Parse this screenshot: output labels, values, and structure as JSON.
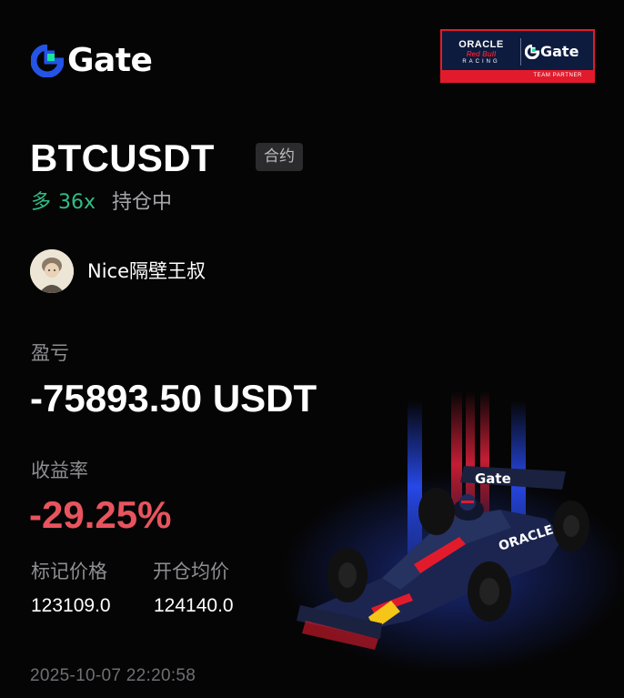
{
  "brand": {
    "name": "Gate",
    "logo_icon": "gate-logo-icon"
  },
  "partner_badge": {
    "oracle": "ORACLE",
    "redbull": "Red Bull",
    "racing": "RACING",
    "gate": "Gate",
    "footer": "TEAM PARTNER"
  },
  "position": {
    "pair": "BTCUSDT",
    "type_tag": "合约",
    "direction": "多",
    "leverage": "36x",
    "status": "持仓中"
  },
  "user": {
    "name": "Nice隔壁王叔",
    "avatar_icon": "avatar-icon"
  },
  "pnl": {
    "label": "盈亏",
    "value": "-75893.50 USDT"
  },
  "roi": {
    "label": "收益率",
    "value": "-29.25%"
  },
  "prices": {
    "mark_label": "标记价格",
    "mark_value": "123109.0",
    "entry_label": "开仓均价",
    "entry_value": "124140.0"
  },
  "timestamp": "2025-10-07 22:20:58",
  "colors": {
    "background": "#050505",
    "long_green": "#2fbd85",
    "loss_red": "#e8545e",
    "muted_text": "#8e8e93",
    "brand_blue": "#2354e6",
    "brand_green": "#17e6a1"
  }
}
